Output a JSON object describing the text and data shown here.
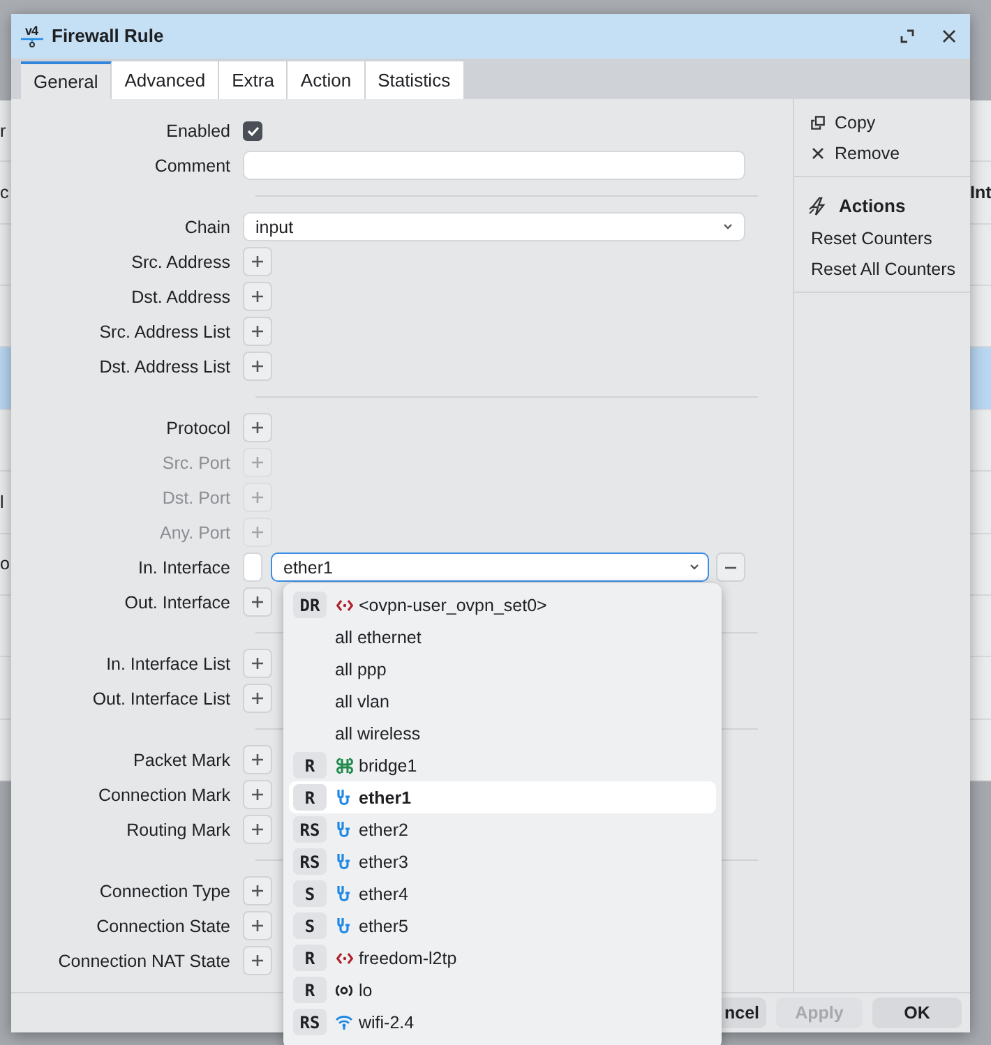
{
  "background": {
    "rows": [
      {
        "left_text": "r",
        "right_text": "",
        "selected": false
      },
      {
        "left_text": "c",
        "right_text": "Int",
        "selected": false
      },
      {
        "left_text": "",
        "right_text": "",
        "selected": false
      },
      {
        "left_text": "",
        "right_text": "",
        "selected": false
      },
      {
        "left_text": "",
        "right_text": "",
        "selected": true
      },
      {
        "left_text": "",
        "right_text": "",
        "selected": false
      },
      {
        "left_text": "l",
        "right_text": "",
        "selected": false
      },
      {
        "left_text": "o",
        "right_text": "",
        "selected": false
      },
      {
        "left_text": "",
        "right_text": "",
        "selected": false
      },
      {
        "left_text": "",
        "right_text": "",
        "selected": false
      },
      {
        "left_text": "",
        "right_text": "",
        "selected": false
      }
    ]
  },
  "dialog": {
    "title": "Firewall Rule",
    "title_icon_text": "v4",
    "tabs": [
      {
        "label": "General",
        "selected": true
      },
      {
        "label": "Advanced",
        "selected": false
      },
      {
        "label": "Extra",
        "selected": false
      },
      {
        "label": "Action",
        "selected": false
      },
      {
        "label": "Statistics",
        "selected": false
      }
    ],
    "form": {
      "sections": [
        {
          "rows": [
            {
              "kind": "checkbox",
              "label": "Enabled",
              "checked": true
            },
            {
              "kind": "text",
              "label": "Comment"
            }
          ]
        },
        {
          "rows": [
            {
              "kind": "select",
              "label": "Chain",
              "value": "input"
            },
            {
              "kind": "add",
              "label": "Src. Address",
              "disabled": false
            },
            {
              "kind": "add",
              "label": "Dst. Address",
              "disabled": false
            },
            {
              "kind": "add",
              "label": "Src. Address List",
              "disabled": false
            },
            {
              "kind": "add",
              "label": "Dst. Address List",
              "disabled": false
            }
          ]
        },
        {
          "rows": [
            {
              "kind": "add",
              "label": "Protocol",
              "disabled": false
            },
            {
              "kind": "add",
              "label": "Src. Port",
              "disabled": true
            },
            {
              "kind": "add",
              "label": "Dst. Port",
              "disabled": true
            },
            {
              "kind": "add",
              "label": "Any. Port",
              "disabled": true
            },
            {
              "kind": "interface",
              "label": "In. Interface",
              "value": "ether1",
              "inverted": false
            },
            {
              "kind": "add",
              "label": "Out. Interface",
              "disabled": false
            }
          ]
        },
        {
          "rows": [
            {
              "kind": "add",
              "label": "In. Interface List",
              "disabled": false
            },
            {
              "kind": "add",
              "label": "Out. Interface List",
              "disabled": false
            }
          ]
        },
        {
          "rows": [
            {
              "kind": "add",
              "label": "Packet Mark",
              "disabled": false
            },
            {
              "kind": "add",
              "label": "Connection Mark",
              "disabled": false
            },
            {
              "kind": "add",
              "label": "Routing Mark",
              "disabled": false
            }
          ]
        },
        {
          "rows": [
            {
              "kind": "add",
              "label": "Connection Type",
              "disabled": false
            },
            {
              "kind": "add",
              "label": "Connection State",
              "disabled": false
            },
            {
              "kind": "add",
              "label": "Connection NAT State",
              "disabled": false
            }
          ]
        }
      ]
    },
    "side_panel": {
      "items": [
        {
          "kind": "copy",
          "label": "Copy"
        },
        {
          "kind": "remove",
          "label": "Remove"
        }
      ],
      "section_title": "Actions",
      "actions": [
        {
          "label": "Reset Counters"
        },
        {
          "label": "Reset All Counters"
        }
      ]
    },
    "footer": {
      "buttons": [
        {
          "kind": "cancel",
          "label": "ncel",
          "disabled": false
        },
        {
          "kind": "apply",
          "label": "Apply",
          "disabled": true
        },
        {
          "kind": "ok",
          "label": "OK",
          "disabled": false
        }
      ]
    }
  },
  "dropdown": {
    "items": [
      {
        "badge": "DR",
        "kind": "tunnel",
        "label": "<ovpn-user_ovpn_set0>",
        "selected": false
      },
      {
        "kind": "list",
        "label": "all ethernet",
        "selected": false
      },
      {
        "kind": "list",
        "label": "all ppp",
        "selected": false
      },
      {
        "kind": "list",
        "label": "all vlan",
        "selected": false
      },
      {
        "kind": "list",
        "label": "all wireless",
        "selected": false
      },
      {
        "badge": "R",
        "kind": "bridge",
        "label": "bridge1",
        "selected": false
      },
      {
        "badge": "R",
        "kind": "ethernet",
        "label": "ether1",
        "selected": true
      },
      {
        "badge": "RS",
        "kind": "ethernet",
        "label": "ether2",
        "selected": false
      },
      {
        "badge": "RS",
        "kind": "ethernet",
        "label": "ether3",
        "selected": false
      },
      {
        "badge": "S",
        "kind": "ethernet",
        "label": "ether4",
        "selected": false
      },
      {
        "badge": "S",
        "kind": "ethernet",
        "label": "ether5",
        "selected": false
      },
      {
        "badge": "R",
        "kind": "tunnel",
        "label": "freedom-l2tp",
        "selected": false
      },
      {
        "badge": "R",
        "kind": "loopback",
        "label": "lo",
        "selected": false
      },
      {
        "badge": "RS",
        "kind": "wireless",
        "label": "wifi-2.4",
        "selected": false
      }
    ]
  }
}
